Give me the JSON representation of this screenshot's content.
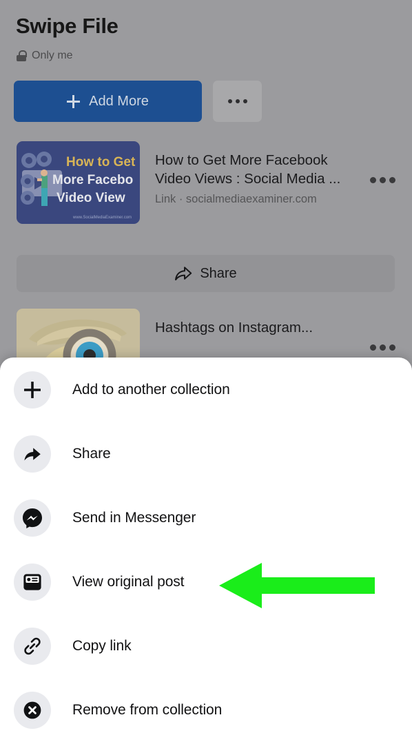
{
  "header": {
    "title": "Swipe File",
    "privacy_label": "Only me",
    "privacy_icon": "lock-icon"
  },
  "toolbar": {
    "add_more_label": "Add More",
    "add_more_icon": "plus-icon",
    "overflow_icon": "ellipsis-icon"
  },
  "saved_items": [
    {
      "title": "How to Get More Facebook Video Views : Social Media ...",
      "subtitle": "Link · socialmediaexaminer.com",
      "thumb_alt": "How to Get More Facebook Video Views",
      "thumb_text_line1": "How to Get",
      "thumb_text_line2": "More Facebo",
      "thumb_text_line3": "Video View",
      "thumb_footer": "www.SocialMediaExaminer.com",
      "overflow_icon": "ellipsis-icon"
    },
    {
      "title": "Hashtags on Instagram...",
      "thumb_alt": "Detective with magnifying glass",
      "overflow_icon": "ellipsis-icon"
    }
  ],
  "share_bar": {
    "label": "Share",
    "icon": "share-arrow-icon"
  },
  "bottom_sheet": {
    "items": [
      {
        "label": "Add to another collection",
        "icon": "plus-icon"
      },
      {
        "label": "Share",
        "icon": "share-arrow-filled-icon"
      },
      {
        "label": "Send in Messenger",
        "icon": "messenger-icon"
      },
      {
        "label": "View original post",
        "icon": "post-card-icon"
      },
      {
        "label": "Copy link",
        "icon": "link-chain-icon"
      },
      {
        "label": "Remove from collection",
        "icon": "close-circle-icon"
      }
    ]
  },
  "annotation": {
    "arrow_icon": "left-arrow-annotation",
    "color": "#1aed1a",
    "points_to": "View original post"
  },
  "colors": {
    "background_dim": "#9b9b9e",
    "primary_button": "#1d4f91",
    "sheet_background": "#ffffff",
    "menu_icon_background": "#e9eaee",
    "annotation_green": "#1aed1a"
  }
}
